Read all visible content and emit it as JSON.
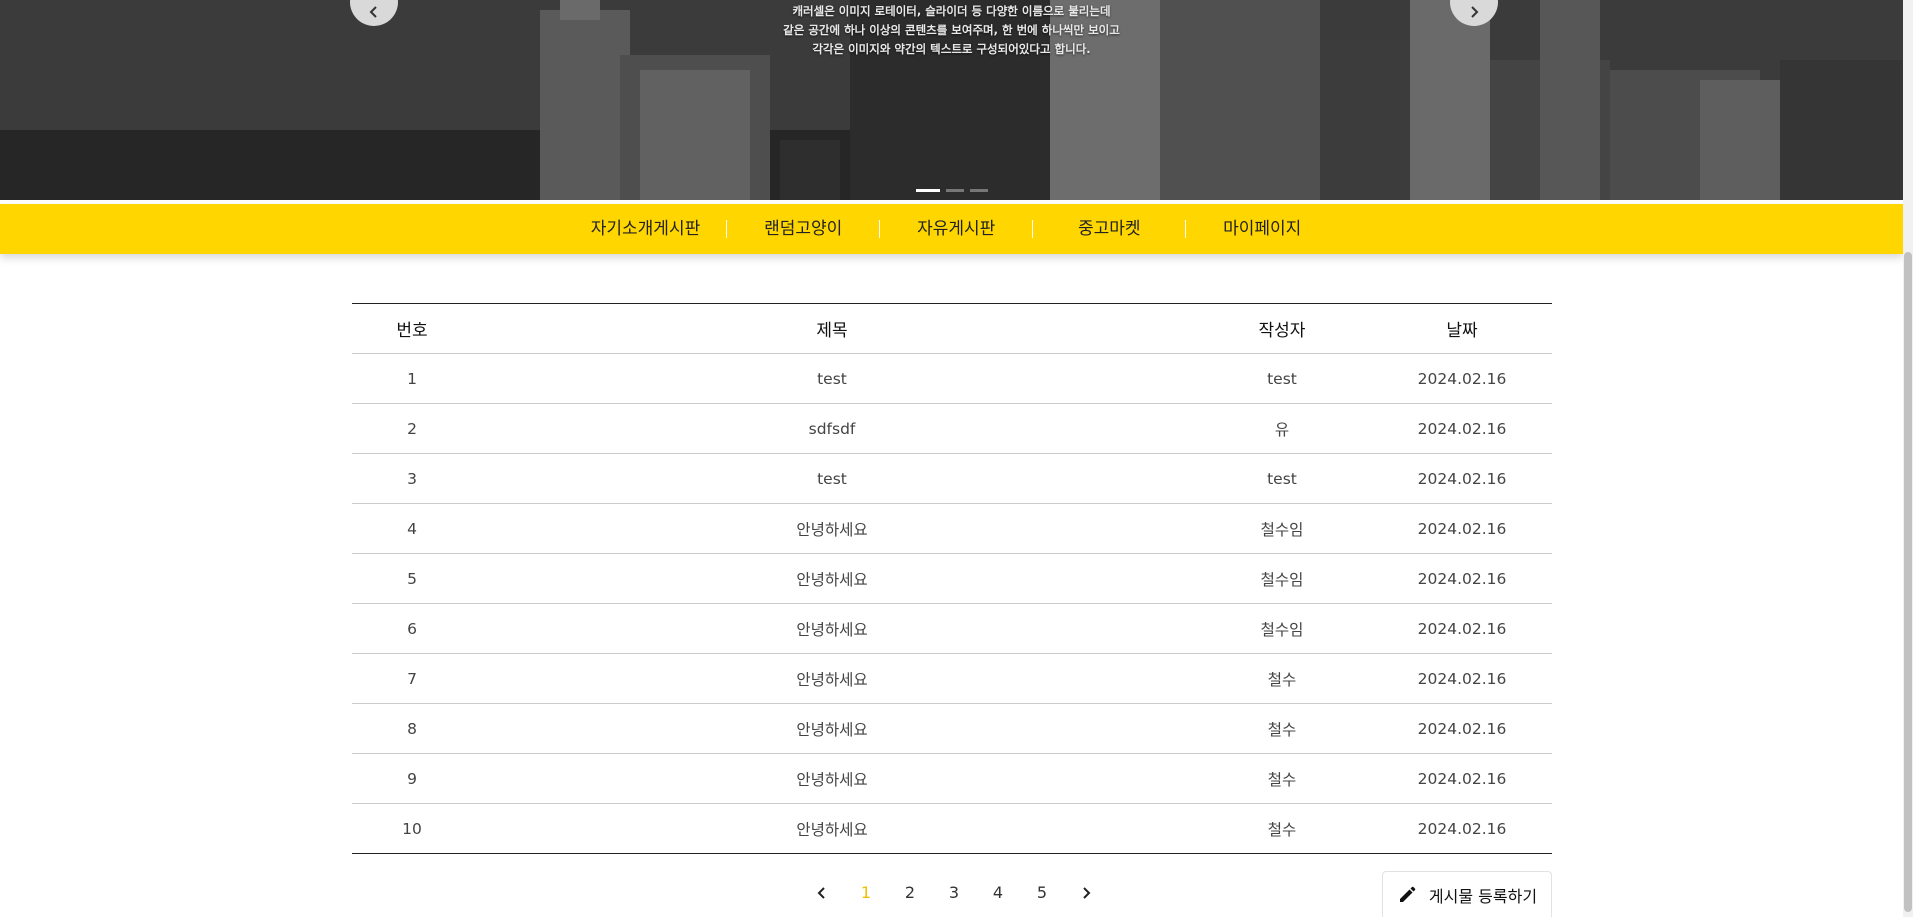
{
  "hero": {
    "text_lines": [
      "캐러셀은 이미지 로테이터, 슬라이더 등 다양한 이름으로 불리는데",
      "같은 공간에 하나 이상의 콘텐츠를 보여주며, 한 번에 하나씩만 보이고",
      "각각은 이미지와 약간의 텍스트로 구성되어있다고 합니다."
    ],
    "prev_icon": "chevron-left-icon",
    "next_icon": "chevron-right-icon",
    "slides_count": 3,
    "active_slide": 1
  },
  "nav": {
    "items": [
      "자기소개게시판",
      "랜덤고양이",
      "자유게시판",
      "중고마켓",
      "마이페이지"
    ],
    "color": "#ffd600"
  },
  "table": {
    "headers": {
      "no": "번호",
      "title": "제목",
      "author": "작성자",
      "date": "날짜"
    },
    "rows": [
      {
        "no": "1",
        "title": "test",
        "author": "test",
        "date": "2024.02.16"
      },
      {
        "no": "2",
        "title": "sdfsdf",
        "author": "유",
        "date": "2024.02.16"
      },
      {
        "no": "3",
        "title": "test",
        "author": "test",
        "date": "2024.02.16"
      },
      {
        "no": "4",
        "title": "안녕하세요",
        "author": "철수임",
        "date": "2024.02.16"
      },
      {
        "no": "5",
        "title": "안녕하세요",
        "author": "철수임",
        "date": "2024.02.16"
      },
      {
        "no": "6",
        "title": "안녕하세요",
        "author": "철수임",
        "date": "2024.02.16"
      },
      {
        "no": "7",
        "title": "안녕하세요",
        "author": "철수",
        "date": "2024.02.16"
      },
      {
        "no": "8",
        "title": "안녕하세요",
        "author": "철수",
        "date": "2024.02.16"
      },
      {
        "no": "9",
        "title": "안녕하세요",
        "author": "철수",
        "date": "2024.02.16"
      },
      {
        "no": "10",
        "title": "안녕하세요",
        "author": "철수",
        "date": "2024.02.16"
      }
    ]
  },
  "pagination": {
    "pages": [
      "1",
      "2",
      "3",
      "4",
      "5"
    ],
    "active": "1",
    "active_color": "#f0c000",
    "prev_icon": "chevron-left-icon",
    "next_icon": "chevron-right-icon"
  },
  "write_button": {
    "label": "게시물 등록하기",
    "icon": "pencil-icon"
  }
}
